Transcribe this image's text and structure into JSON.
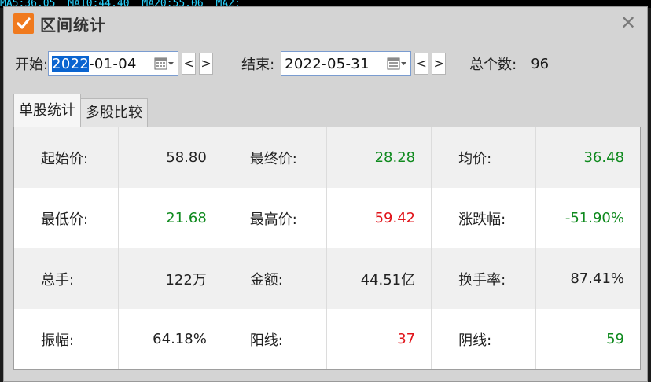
{
  "window": {
    "title": "区间统计",
    "close_label": "✕"
  },
  "background_strip": [
    "MA5:36.05",
    "MA10:44.40",
    "MA20:55.06",
    "MA2:"
  ],
  "toolbar": {
    "start_label": "开始:",
    "start_value_selected": "2022",
    "start_value_rest": "-01-04",
    "end_label": "结束:",
    "end_value": "2022-05-31",
    "prev_label": "<",
    "next_label": ">",
    "count_label": "总个数:",
    "count_value": "96"
  },
  "tabs": [
    {
      "label": "单股统计",
      "active": true
    },
    {
      "label": "多股比较",
      "active": false
    }
  ],
  "colors": {
    "up": "#e0151b",
    "down": "#0f8a1e",
    "neutral": "#222222",
    "accent": "#f07a1e"
  },
  "stats": [
    [
      {
        "label": "起始价:",
        "value": "58.80",
        "tone": "black"
      },
      {
        "label": "最终价:",
        "value": "28.28",
        "tone": "green"
      },
      {
        "label": "均价:",
        "value": "36.48",
        "tone": "green"
      }
    ],
    [
      {
        "label": "最低价:",
        "value": "21.68",
        "tone": "green"
      },
      {
        "label": "最高价:",
        "value": "59.42",
        "tone": "red"
      },
      {
        "label": "涨跌幅:",
        "value": "-51.90%",
        "tone": "green"
      }
    ],
    [
      {
        "label": "总手:",
        "value": "122万",
        "tone": "black"
      },
      {
        "label": "金额:",
        "value": "44.51亿",
        "tone": "black"
      },
      {
        "label": "换手率:",
        "value": "87.41%",
        "tone": "black"
      }
    ],
    [
      {
        "label": "振幅:",
        "value": "64.18%",
        "tone": "black"
      },
      {
        "label": "阳线:",
        "value": "37",
        "tone": "red"
      },
      {
        "label": "阴线:",
        "value": "59",
        "tone": "green"
      }
    ]
  ]
}
